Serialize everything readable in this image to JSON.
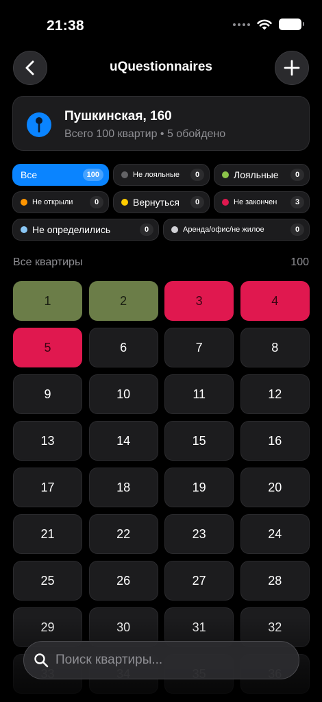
{
  "status_bar": {
    "time": "21:38"
  },
  "nav": {
    "title": "uQuestionnaires"
  },
  "address": {
    "title": "Пушкинская, 160",
    "subtitle": "Всего 100 квартир • 5 обойдено"
  },
  "filters": [
    [
      {
        "label": "Все",
        "count": "100",
        "active": true,
        "color": ""
      },
      {
        "label": "Не лояльные",
        "count": "0",
        "active": false,
        "color": "#636366"
      },
      {
        "label": "Лояльные",
        "count": "0",
        "active": false,
        "color": "#8bc34a"
      }
    ],
    [
      {
        "label": "Не открыли",
        "count": "0",
        "active": false,
        "color": "#ff9500"
      },
      {
        "label": "Вернуться",
        "count": "0",
        "active": false,
        "color": "#ffcc00"
      },
      {
        "label": "Не закончен",
        "count": "3",
        "active": false,
        "color": "#e0184f"
      }
    ],
    [
      {
        "label": "Не определились",
        "count": "0",
        "active": false,
        "color": "#8ac7f5"
      },
      {
        "label": "Аренда/офис/не жилое",
        "count": "0",
        "active": false,
        "color": "#d1d1d6"
      }
    ]
  ],
  "section": {
    "label": "Все квартиры",
    "count": "100"
  },
  "apartments": [
    {
      "number": "1",
      "status": "loyal"
    },
    {
      "number": "2",
      "status": "loyal"
    },
    {
      "number": "3",
      "status": "unfinished"
    },
    {
      "number": "4",
      "status": "unfinished"
    },
    {
      "number": "5",
      "status": "unfinished"
    },
    {
      "number": "6",
      "status": "none"
    },
    {
      "number": "7",
      "status": "none"
    },
    {
      "number": "8",
      "status": "none"
    },
    {
      "number": "9",
      "status": "none"
    },
    {
      "number": "10",
      "status": "none"
    },
    {
      "number": "11",
      "status": "none"
    },
    {
      "number": "12",
      "status": "none"
    },
    {
      "number": "13",
      "status": "none"
    },
    {
      "number": "14",
      "status": "none"
    },
    {
      "number": "15",
      "status": "none"
    },
    {
      "number": "16",
      "status": "none"
    },
    {
      "number": "17",
      "status": "none"
    },
    {
      "number": "18",
      "status": "none"
    },
    {
      "number": "19",
      "status": "none"
    },
    {
      "number": "20",
      "status": "none"
    },
    {
      "number": "21",
      "status": "none"
    },
    {
      "number": "22",
      "status": "none"
    },
    {
      "number": "23",
      "status": "none"
    },
    {
      "number": "24",
      "status": "none"
    },
    {
      "number": "25",
      "status": "none"
    },
    {
      "number": "26",
      "status": "none"
    },
    {
      "number": "27",
      "status": "none"
    },
    {
      "number": "28",
      "status": "none"
    },
    {
      "number": "29",
      "status": "none"
    },
    {
      "number": "30",
      "status": "none"
    },
    {
      "number": "31",
      "status": "none"
    },
    {
      "number": "32",
      "status": "none"
    },
    {
      "number": "33",
      "status": "none"
    },
    {
      "number": "34",
      "status": "none"
    },
    {
      "number": "35",
      "status": "none"
    },
    {
      "number": "36",
      "status": "none"
    }
  ],
  "search": {
    "placeholder": "Поиск квартиры..."
  },
  "icons": {
    "back": "chevron-left-icon",
    "add": "plus-icon",
    "pin": "map-pin-icon",
    "search": "search-icon",
    "wifi": "wifi-icon",
    "battery": "battery-icon"
  }
}
